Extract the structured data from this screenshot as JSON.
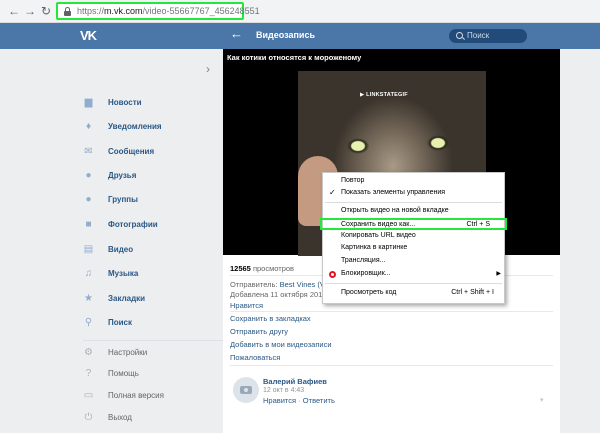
{
  "browser": {
    "back_icon": "arrow-left-icon",
    "forward_icon": "arrow-right-icon",
    "reload_icon": "reload-icon",
    "url_prefix": "https://",
    "url_host": "m.vk.com",
    "url_path": "/video-55667767_456248551"
  },
  "header": {
    "logo": "VK",
    "title": "Видеозапись",
    "search_placeholder": "Поиск"
  },
  "sidebar": {
    "items": [
      {
        "label": "Новости",
        "icon": "news-icon"
      },
      {
        "label": "Уведомления",
        "icon": "bell-icon"
      },
      {
        "label": "Сообщения",
        "icon": "message-icon"
      },
      {
        "label": "Друзья",
        "icon": "friends-icon"
      },
      {
        "label": "Группы",
        "icon": "groups-icon"
      },
      {
        "label": "Фотографии",
        "icon": "camera-icon"
      },
      {
        "label": "Видео",
        "icon": "film-icon"
      },
      {
        "label": "Музыка",
        "icon": "music-icon"
      },
      {
        "label": "Закладки",
        "icon": "star-icon"
      },
      {
        "label": "Поиск",
        "icon": "search-icon"
      }
    ],
    "secondary": [
      {
        "label": "Настройки",
        "icon": "gear-icon"
      },
      {
        "label": "Помощь",
        "icon": "help-icon"
      },
      {
        "label": "Полная версия",
        "icon": "monitor-icon"
      },
      {
        "label": "Выход",
        "icon": "power-icon"
      }
    ]
  },
  "video": {
    "title": "Как котики относятся к мороженому",
    "watermark": "▶ LINKSTATEGIF",
    "views_count": "12565",
    "views_label": "просмотров",
    "sender_prefix": "Отправитель:",
    "sender": "Best Vines (Vid",
    "added": "Добавлена 11 октября 2018",
    "actions": [
      "Нравится",
      "Сохранить в закладках",
      "Отправить другу",
      "Добавить в мои видеозаписи",
      "Пожаловаться"
    ]
  },
  "comment": {
    "author": "Валерий Вафиев",
    "date": "12 окт в 4:43",
    "like": "Нравится",
    "separator": "·",
    "reply": "Ответить"
  },
  "context_menu": {
    "items": [
      {
        "label": "Повтор",
        "shortcut": ""
      },
      {
        "label": "Показать элементы управления",
        "shortcut": "",
        "checked": true
      },
      {
        "label": "Открыть видео на новой вкладке",
        "shortcut": ""
      },
      {
        "label": "Сохранить видео как...",
        "shortcut": "Ctrl + S",
        "highlighted": true
      },
      {
        "label": "Копировать URL видео",
        "shortcut": ""
      },
      {
        "label": "Картинка в картинке",
        "shortcut": ""
      },
      {
        "label": "Трансляция...",
        "shortcut": ""
      },
      {
        "label": "Блокировщик...",
        "shortcut": "",
        "icon": "opera-icon",
        "submenu": true
      },
      {
        "label": "Просмотреть код",
        "shortcut": "Ctrl + Shift + I"
      }
    ]
  },
  "colors": {
    "vk_blue": "#4a76a8",
    "link": "#2a5885",
    "highlight": "#23e83a"
  }
}
